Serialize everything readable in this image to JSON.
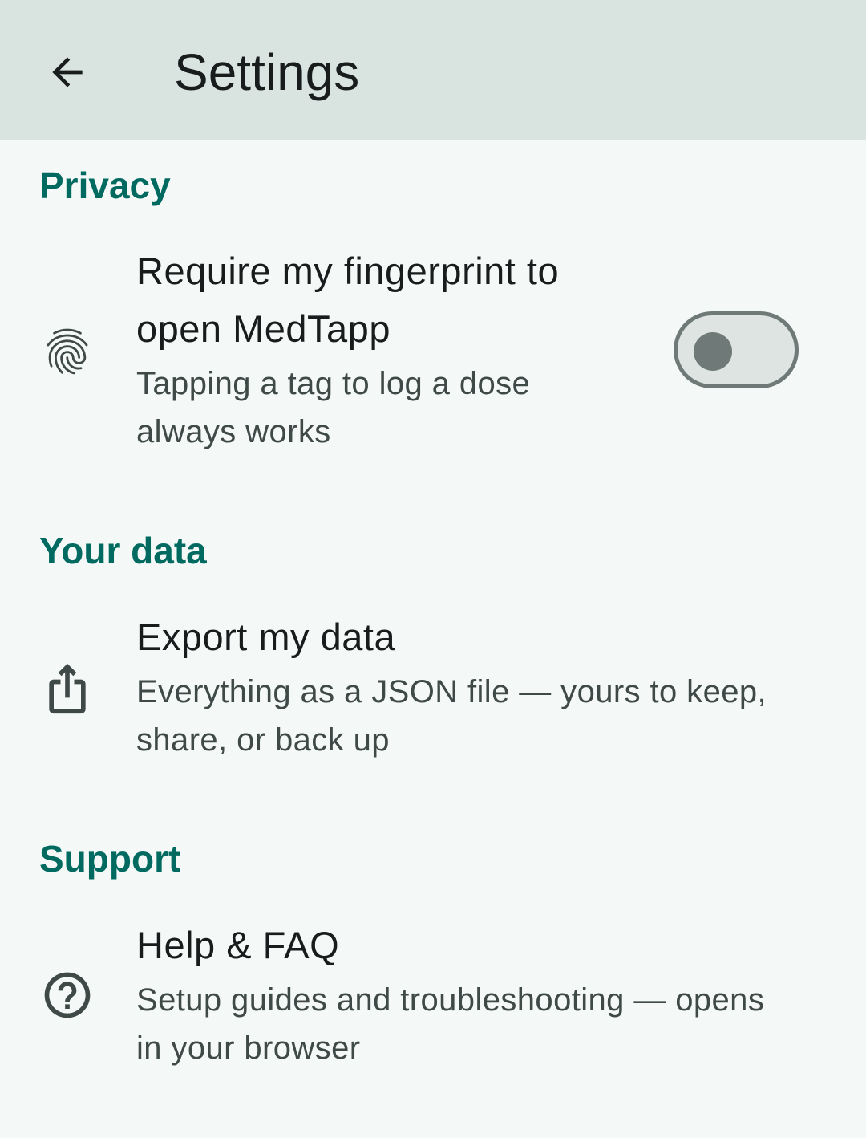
{
  "app_bar": {
    "title": "Settings",
    "back_icon": "arrow-back-icon"
  },
  "sections": {
    "privacy": {
      "header": "Privacy",
      "fingerprint": {
        "icon": "fingerprint-icon",
        "title_line1": "Require my fingerprint to",
        "title_line2": "open MedTapp",
        "summary_line1": "Tapping a tag to log a dose",
        "summary_line2": "always works",
        "switch_on": false
      }
    },
    "your_data": {
      "header": "Your data",
      "export": {
        "icon": "share-icon",
        "title": "Export my data",
        "summary_line1": "Everything as a JSON file — yours to keep,",
        "summary_line2": "share, or back up"
      }
    },
    "support": {
      "header": "Support",
      "help": {
        "icon": "help-circle-icon",
        "title": "Help & FAQ",
        "summary_line1": "Setup guides and troubleshooting — opens",
        "summary_line2": "in your browser"
      }
    }
  },
  "colors": {
    "app_bar_bg": "#d9e4e1",
    "page_bg": "#f4f9f7",
    "accent": "#006a60",
    "switch_outline": "#6f7977",
    "switch_track": "#dde4e1"
  }
}
